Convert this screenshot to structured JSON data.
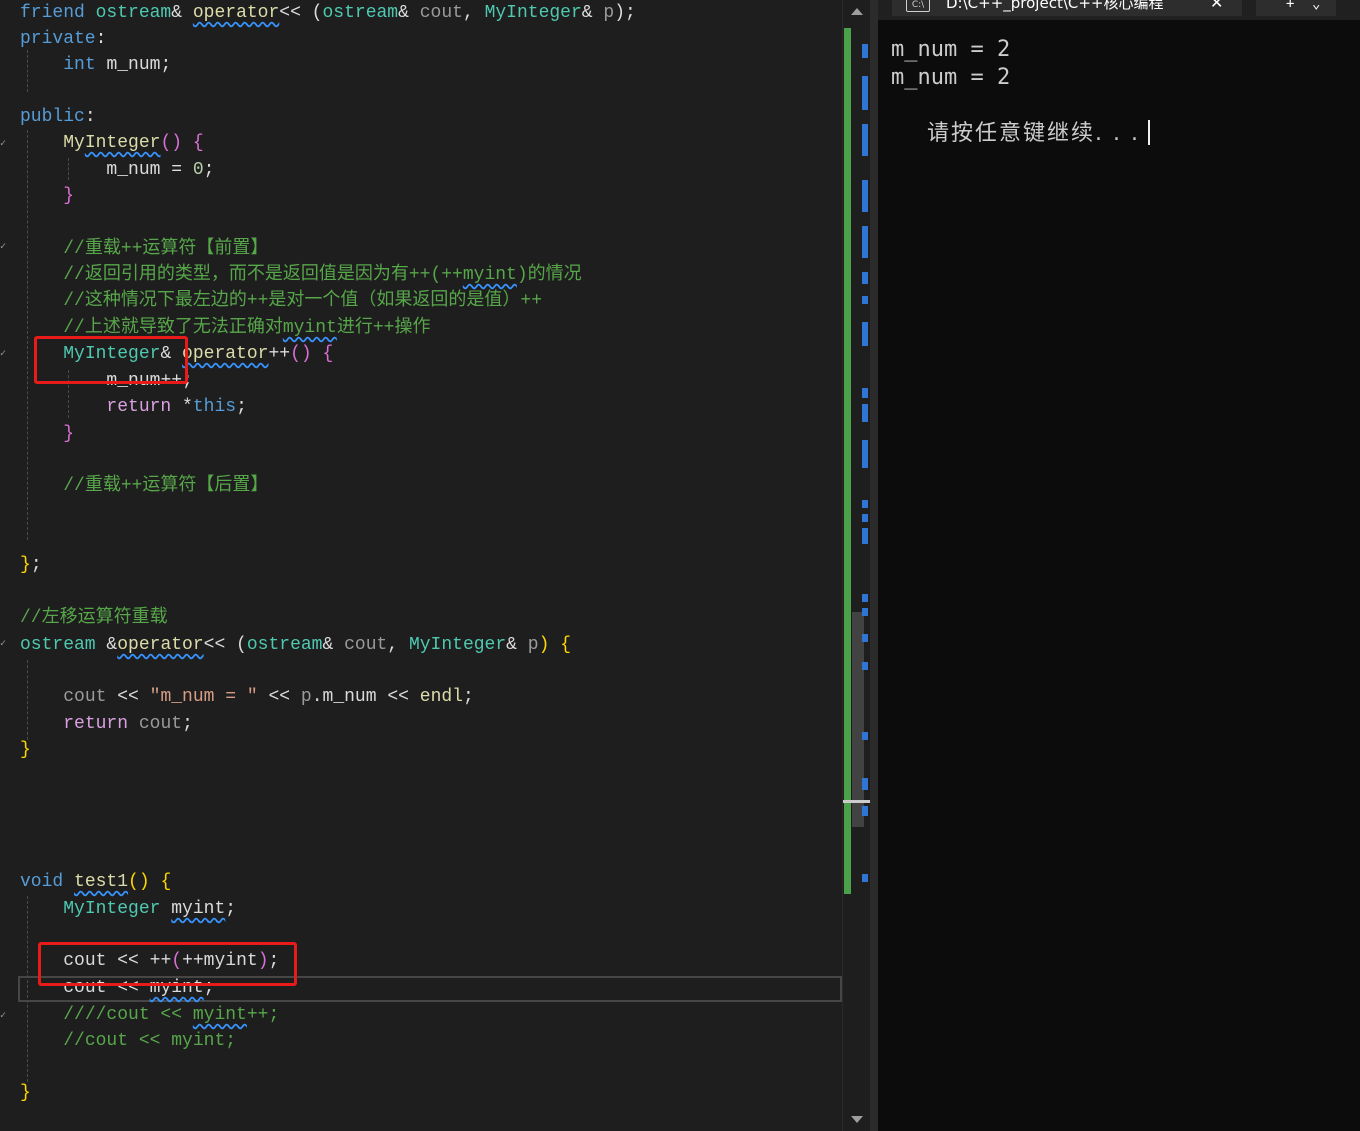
{
  "editor": {
    "lines": [
      {
        "id": "l1",
        "tokens": [
          [
            "kw",
            "friend"
          ],
          [
            "",
            " "
          ],
          [
            "ty",
            "ostream"
          ],
          [
            "",
            "& "
          ],
          [
            "fn sq",
            "operator"
          ],
          [
            "",
            "<< ("
          ],
          [
            "ty",
            "ostream"
          ],
          [
            "",
            "& "
          ],
          [
            "pm",
            "cout"
          ],
          [
            "",
            ", "
          ],
          [
            "ty",
            "MyInteger"
          ],
          [
            "",
            "& "
          ],
          [
            "pm",
            "p"
          ],
          [
            "",
            ");"
          ]
        ]
      },
      {
        "id": "l2",
        "tokens": [
          [
            "kw",
            "private"
          ],
          [
            "",
            ":"
          ]
        ]
      },
      {
        "id": "l3",
        "tokens": [
          [
            "",
            "    "
          ],
          [
            "kw",
            "int"
          ],
          [
            "",
            ""
          ],
          [
            "",
            " "
          ],
          [
            "vr",
            "m_num"
          ],
          [
            "",
            ";"
          ]
        ]
      },
      {
        "id": "l4",
        "tokens": [
          [
            "kw",
            "public"
          ],
          [
            "",
            ":"
          ]
        ]
      },
      {
        "id": "l5",
        "tokens": [
          [
            "",
            "    "
          ],
          [
            "fn",
            "My"
          ],
          [
            "fn sq",
            "Integer"
          ],
          [
            "br2",
            "()"
          ],
          [
            "",
            " "
          ],
          [
            "br2",
            "{"
          ]
        ]
      },
      {
        "id": "l6",
        "tokens": [
          [
            "",
            "        "
          ],
          [
            "vr",
            "m_num"
          ],
          [
            "",
            " = "
          ],
          [
            "num",
            "0"
          ],
          [
            "",
            ";"
          ]
        ]
      },
      {
        "id": "l7",
        "tokens": [
          [
            "",
            "    "
          ],
          [
            "br2",
            "}"
          ]
        ]
      },
      {
        "id": "l8",
        "tokens": [
          [
            "",
            "    "
          ],
          [
            "cm",
            "//重载++运算符【前置】"
          ]
        ]
      },
      {
        "id": "l9",
        "tokens": [
          [
            "",
            "    "
          ],
          [
            "cm",
            "//返回引用的类型，而不是返回值是因为有++(++"
          ],
          [
            "cm sq",
            "myint"
          ],
          [
            "cm",
            ")的情况"
          ]
        ]
      },
      {
        "id": "l10",
        "tokens": [
          [
            "",
            "    "
          ],
          [
            "cm",
            "//这种情况下最左边的++是对一个值（如果返回的是值）++"
          ]
        ]
      },
      {
        "id": "l11",
        "tokens": [
          [
            "",
            "    "
          ],
          [
            "cm",
            "//上述就导致了无法正确对"
          ],
          [
            "cm sq",
            "myint"
          ],
          [
            "cm",
            "进行++操作"
          ]
        ]
      },
      {
        "id": "l12",
        "tokens": [
          [
            "",
            "    "
          ],
          [
            "ty",
            "MyInteger"
          ],
          [
            "",
            "& "
          ],
          [
            "fn sq",
            "operator"
          ],
          [
            "",
            "++"
          ],
          [
            "br2",
            "()"
          ],
          [
            "",
            " "
          ],
          [
            "br2",
            "{"
          ]
        ]
      },
      {
        "id": "l13",
        "tokens": [
          [
            "",
            "        "
          ],
          [
            "vr",
            "m_num"
          ],
          [
            "",
            "++;"
          ]
        ]
      },
      {
        "id": "l14",
        "tokens": [
          [
            "",
            "        "
          ],
          [
            "kw2",
            "return"
          ],
          [
            "",
            " *"
          ],
          [
            "kw",
            "this"
          ],
          [
            "",
            ";"
          ]
        ]
      },
      {
        "id": "l15",
        "tokens": [
          [
            "",
            "    "
          ],
          [
            "br2",
            "}"
          ]
        ]
      },
      {
        "id": "l16",
        "tokens": [
          [
            "",
            "    "
          ],
          [
            "cm",
            "//重载++运算符【后置】"
          ]
        ]
      },
      {
        "id": "l17",
        "tokens": [
          [
            "br1",
            "}"
          ],
          [
            "",
            ";"
          ]
        ]
      },
      {
        "id": "l18",
        "tokens": [
          [
            "cm",
            "//左移运算符重载"
          ]
        ]
      },
      {
        "id": "l19",
        "tokens": [
          [
            "ty",
            "ostream"
          ],
          [
            "",
            " &"
          ],
          [
            "fn sq",
            "operator"
          ],
          [
            "",
            "<< ("
          ],
          [
            "ty",
            "ostream"
          ],
          [
            "",
            "& "
          ],
          [
            "pm",
            "cout"
          ],
          [
            "",
            ", "
          ],
          [
            "ty",
            "MyInteger"
          ],
          [
            "",
            "& "
          ],
          [
            "pm",
            "p"
          ],
          [
            "br1",
            ")"
          ],
          [
            "",
            " "
          ],
          [
            "br1",
            "{"
          ]
        ]
      },
      {
        "id": "l20",
        "tokens": [
          [
            "",
            "    "
          ],
          [
            "pm",
            "cout"
          ],
          [
            "",
            " << "
          ],
          [
            "str",
            "\"m_num = \""
          ],
          [
            "",
            " << "
          ],
          [
            "pm",
            "p"
          ],
          [
            "",
            "."
          ],
          [
            "vr",
            "m_num"
          ],
          [
            "",
            " << "
          ],
          [
            "fn",
            "endl"
          ],
          [
            "",
            ";"
          ]
        ]
      },
      {
        "id": "l21",
        "tokens": [
          [
            "",
            "    "
          ],
          [
            "kw2",
            "return"
          ],
          [
            "",
            " "
          ],
          [
            "pm",
            "cout"
          ],
          [
            "",
            ";"
          ]
        ]
      },
      {
        "id": "l22",
        "tokens": [
          [
            "br1",
            "}"
          ]
        ]
      },
      {
        "id": "l23",
        "tokens": [
          [
            "kw",
            "void"
          ],
          [
            "",
            " "
          ],
          [
            "fn sq",
            "test1"
          ],
          [
            "br1",
            "()"
          ],
          [
            "",
            " "
          ],
          [
            "br1",
            "{"
          ]
        ]
      },
      {
        "id": "l24",
        "tokens": [
          [
            "",
            "    "
          ],
          [
            "ty",
            "MyInteger"
          ],
          [
            "",
            " "
          ],
          [
            "vr sq",
            "myint"
          ],
          [
            "",
            ";"
          ]
        ]
      },
      {
        "id": "l25",
        "tokens": [
          [
            "",
            "    "
          ],
          [
            "vr",
            "cout"
          ],
          [
            "",
            " << ++"
          ],
          [
            "br2",
            "("
          ],
          [
            "",
            "++"
          ],
          [
            "vr",
            "myint"
          ],
          [
            "br2",
            ")"
          ],
          [
            "",
            ";"
          ]
        ]
      },
      {
        "id": "l26",
        "tokens": [
          [
            "",
            "    "
          ],
          [
            "vr",
            "cout"
          ],
          [
            "",
            " << "
          ],
          [
            "vr sq",
            "myint"
          ],
          [
            "",
            ";"
          ]
        ]
      },
      {
        "id": "l27",
        "tokens": [
          [
            "",
            "    "
          ],
          [
            "cm",
            "////cout << "
          ],
          [
            "cm sq",
            "myint"
          ],
          [
            "cm",
            "++;"
          ]
        ]
      },
      {
        "id": "l28",
        "tokens": [
          [
            "",
            "    "
          ],
          [
            "cm",
            "//cout << myint;"
          ]
        ]
      },
      {
        "id": "l29",
        "tokens": [
          [
            "br1",
            "}"
          ]
        ]
      }
    ]
  },
  "console": {
    "tab_title": "D:\\C++_project\\C++核心编程",
    "tab_icon": "C:\\",
    "tab_close": "✕",
    "newtab_plus": "+",
    "newtab_dropdown": "⌄",
    "output": [
      "m_num = 2",
      "m_num = 2",
      "请按任意键继续. . ."
    ]
  },
  "icons": {
    "terminal-icon": "console app icon",
    "close-icon": "✕",
    "plus-icon": "+",
    "chevron-down-icon": "⌄"
  }
}
